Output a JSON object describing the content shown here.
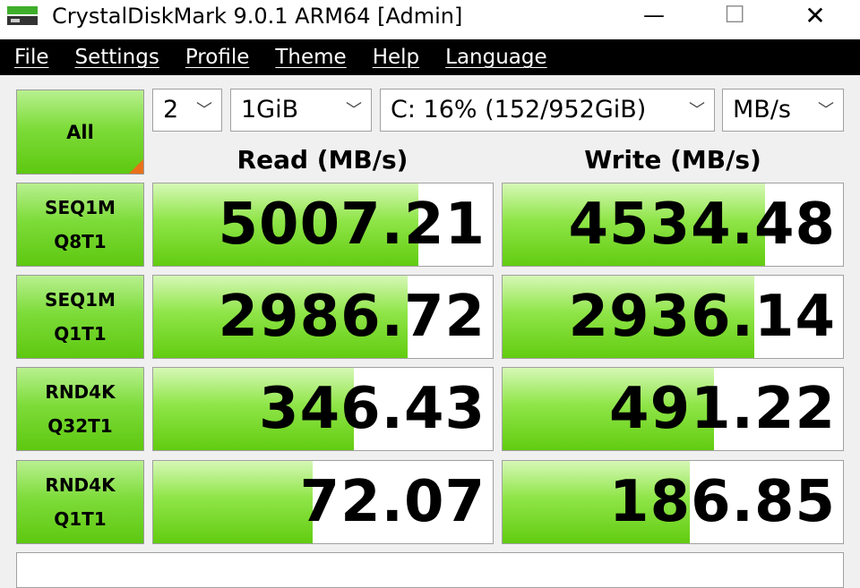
{
  "window": {
    "title": "CrystalDiskMark 9.0.1 ARM64 [Admin]",
    "controls": {
      "minimize": "—",
      "maximize": "☐",
      "close": "✕"
    }
  },
  "menu": [
    {
      "label": "File"
    },
    {
      "label": "Settings"
    },
    {
      "label": "Profile"
    },
    {
      "label": "Theme"
    },
    {
      "label": "Help"
    },
    {
      "label": "Language"
    }
  ],
  "toolbar": {
    "all_label": "All",
    "count": "2",
    "size": "1GiB",
    "drive": "C: 16% (152/952GiB)",
    "unit": "MB/s"
  },
  "headers": {
    "read": "Read (MB/s)",
    "write": "Write (MB/s)"
  },
  "tests": [
    {
      "line1": "SEQ1M",
      "line2": "Q8T1",
      "read": "5007.21",
      "write": "4534.48",
      "read_fill": 0.78,
      "write_fill": 0.77
    },
    {
      "line1": "SEQ1M",
      "line2": "Q1T1",
      "read": "2986.72",
      "write": "2936.14",
      "read_fill": 0.75,
      "write_fill": 0.74
    },
    {
      "line1": "RND4K",
      "line2": "Q32T1",
      "read": "346.43",
      "write": "491.22",
      "read_fill": 0.59,
      "write_fill": 0.62
    },
    {
      "line1": "RND4K",
      "line2": "Q1T1",
      "read": "72.07",
      "write": "186.85",
      "read_fill": 0.47,
      "write_fill": 0.55
    }
  ],
  "colors": {
    "accent_green": "#62cc10",
    "corner_orange": "#e8701a",
    "menu_bg": "#000000"
  },
  "comment": ""
}
